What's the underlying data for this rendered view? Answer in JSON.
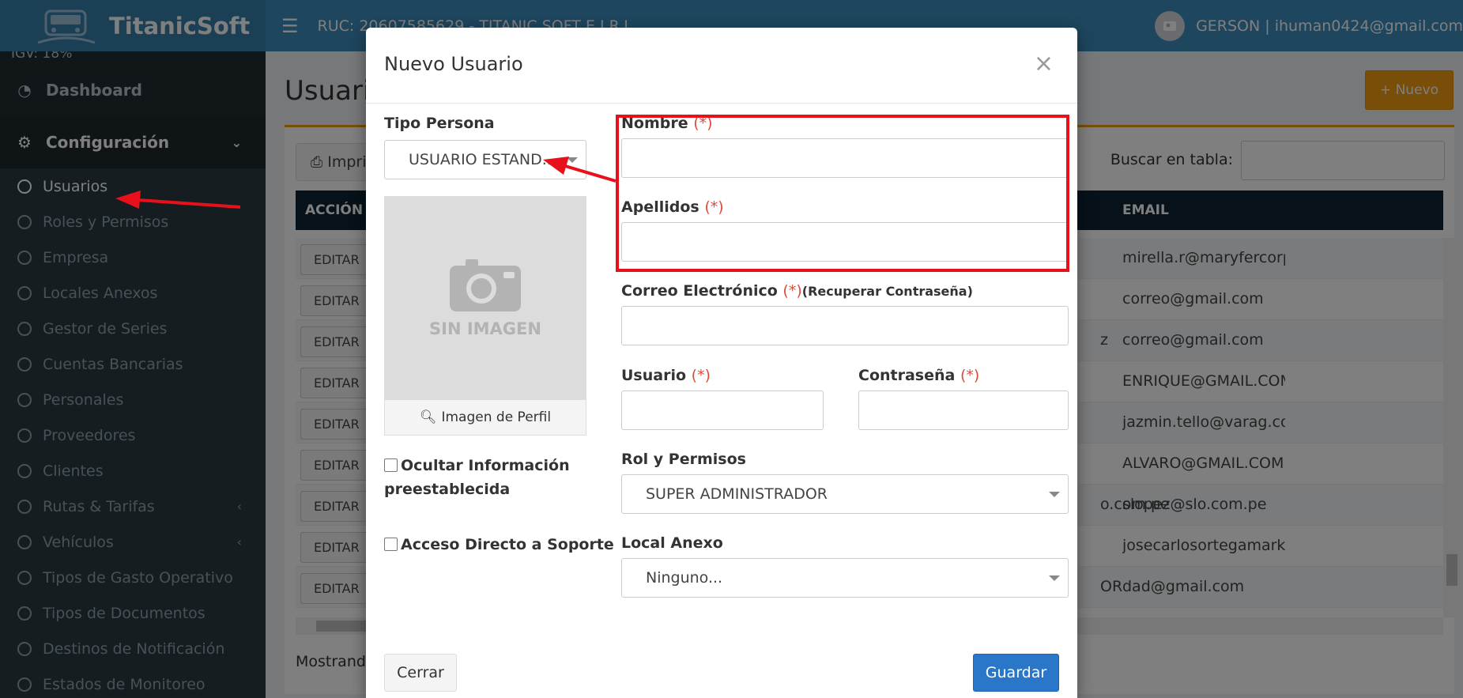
{
  "header": {
    "brand": "TitanicSoft",
    "ruc": "RUC: 20607585629 - TITANIC SOFT E.I.R.L.",
    "user": "GERSON | ihuman0424@gmail.com"
  },
  "sidebar": {
    "igv": "IGV: 18%",
    "dashboard": "Dashboard",
    "configuracion": "Configuración",
    "items": [
      {
        "label": "Usuarios"
      },
      {
        "label": "Roles y Permisos"
      },
      {
        "label": "Empresa"
      },
      {
        "label": "Locales Anexos"
      },
      {
        "label": "Gestor de Series"
      },
      {
        "label": "Cuentas Bancarias"
      },
      {
        "label": "Personales"
      },
      {
        "label": "Proveedores"
      },
      {
        "label": "Clientes"
      },
      {
        "label": "Rutas & Tarifas"
      },
      {
        "label": "Vehículos"
      },
      {
        "label": "Tipos de Gasto Operativo"
      },
      {
        "label": "Tipos de Documentos"
      },
      {
        "label": "Destinos de Notificación"
      },
      {
        "label": "Estados de Monitoreo"
      }
    ]
  },
  "page": {
    "title": "Usuarios",
    "nuevo_label": "Nuevo",
    "print_label": "Imprimir",
    "search_label": "Buscar en tabla:",
    "col_accion": "ACCIÓN",
    "col_email": "EMAIL",
    "mostrando": "Mostrando",
    "rows": [
      {
        "btn": "EDITAR",
        "mid": "",
        "email": "mirella.r@maryfercorp"
      },
      {
        "btn": "EDITAR",
        "mid": "",
        "email": "correo@gmail.com"
      },
      {
        "btn": "EDITAR",
        "mid": "z",
        "email": "correo@gmail.com"
      },
      {
        "btn": "EDITAR",
        "mid": "",
        "email": "ENRIQUE@GMAIL.COM"
      },
      {
        "btn": "EDITAR",
        "mid": "",
        "email": "jazmin.tello@varag.com"
      },
      {
        "btn": "EDITAR",
        "mid": "",
        "email": "ALVARO@GMAIL.COM"
      },
      {
        "btn": "EDITAR",
        "mid": "o.com.pe",
        "email": "slopez@slo.com.pe"
      },
      {
        "btn": "EDITAR",
        "mid": "",
        "email": "josecarlosortegamark("
      },
      {
        "btn": "EDITAR",
        "mid": "OR",
        "email": "dad@gmail.com"
      }
    ]
  },
  "modal": {
    "title": "Nuevo Usuario",
    "close": "×",
    "tipo_persona_label": "Tipo Persona",
    "tipo_persona_value": "USUARIO ESTAND...",
    "sin_imagen": "SIN IMAGEN",
    "imagen_btn": "Imagen de Perfil",
    "ocultar_label": "Ocultar Información preestablecida",
    "soporte_label": "Acceso Directo a Soporte",
    "nombre_label": "Nombre",
    "apellidos_label": "Apellidos",
    "correo_label": "Correo Electrónico",
    "correo_hint": "(Recuperar Contraseña)",
    "usuario_label": "Usuario",
    "contrasena_label": "Contraseña",
    "required_mark": "(*)",
    "rol_label": "Rol y Permisos",
    "rol_value": "SUPER ADMINISTRADOR",
    "local_label": "Local Anexo",
    "local_value": "Ninguno...",
    "cerrar_label": "Cerrar",
    "guardar_label": "Guardar"
  },
  "colors": {
    "header": "#3c8dbc",
    "sidebar": "#222d32",
    "accent_orange": "#f39c12",
    "primary_button": "#2a76c9",
    "annotation_red": "#e8101a",
    "required_red": "#dd4b39"
  }
}
